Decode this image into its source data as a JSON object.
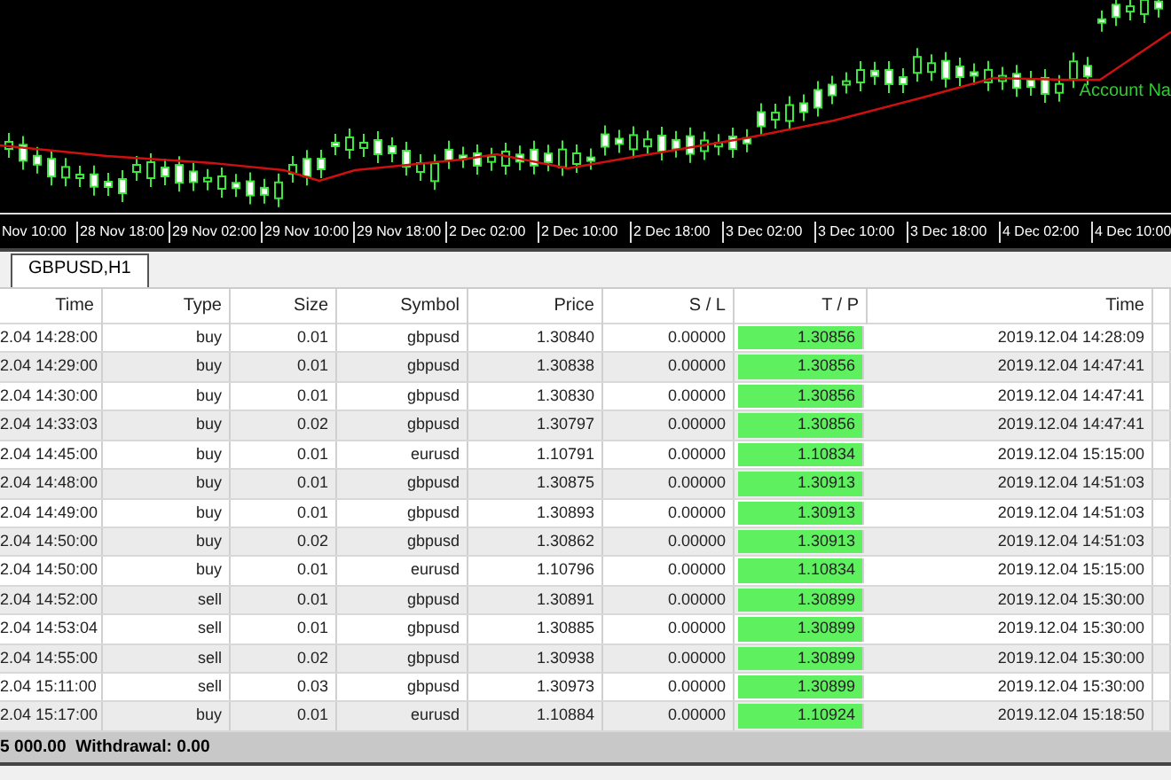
{
  "chart": {
    "account_label": "Account Na",
    "time_axis": [
      "Nov 10:00",
      "28 Nov 18:00",
      "29 Nov 02:00",
      "29 Nov 10:00",
      "29 Nov 18:00",
      "2 Dec 02:00",
      "2 Dec 10:00",
      "2 Dec 18:00",
      "3 Dec 02:00",
      "3 Dec 10:00",
      "3 Dec 18:00",
      "4 Dec 02:00",
      "4 Dec 10:00"
    ]
  },
  "chart_tabs": [
    {
      "label": "GBPUSD,H1",
      "selected": true
    }
  ],
  "table": {
    "columns": [
      "Time",
      "Type",
      "Size",
      "Symbol",
      "Price",
      "S / L",
      "T / P",
      "Time"
    ],
    "rows": [
      {
        "cells": [
          "2.04 14:28:00",
          "buy",
          "0.01",
          "gbpusd",
          "1.30840",
          "0.00000",
          "1.30856",
          "2019.12.04 14:28:09"
        ],
        "tp_hit": true
      },
      {
        "cells": [
          "2.04 14:29:00",
          "buy",
          "0.01",
          "gbpusd",
          "1.30838",
          "0.00000",
          "1.30856",
          "2019.12.04 14:47:41"
        ],
        "tp_hit": true
      },
      {
        "cells": [
          "2.04 14:30:00",
          "buy",
          "0.01",
          "gbpusd",
          "1.30830",
          "0.00000",
          "1.30856",
          "2019.12.04 14:47:41"
        ],
        "tp_hit": true
      },
      {
        "cells": [
          "2.04 14:33:03",
          "buy",
          "0.02",
          "gbpusd",
          "1.30797",
          "0.00000",
          "1.30856",
          "2019.12.04 14:47:41"
        ],
        "tp_hit": true
      },
      {
        "cells": [
          "2.04 14:45:00",
          "buy",
          "0.01",
          "eurusd",
          "1.10791",
          "0.00000",
          "1.10834",
          "2019.12.04 15:15:00"
        ],
        "tp_hit": true
      },
      {
        "cells": [
          "2.04 14:48:00",
          "buy",
          "0.01",
          "gbpusd",
          "1.30875",
          "0.00000",
          "1.30913",
          "2019.12.04 14:51:03"
        ],
        "tp_hit": true
      },
      {
        "cells": [
          "2.04 14:49:00",
          "buy",
          "0.01",
          "gbpusd",
          "1.30893",
          "0.00000",
          "1.30913",
          "2019.12.04 14:51:03"
        ],
        "tp_hit": true
      },
      {
        "cells": [
          "2.04 14:50:00",
          "buy",
          "0.02",
          "gbpusd",
          "1.30862",
          "0.00000",
          "1.30913",
          "2019.12.04 14:51:03"
        ],
        "tp_hit": true
      },
      {
        "cells": [
          "2.04 14:50:00",
          "buy",
          "0.01",
          "eurusd",
          "1.10796",
          "0.00000",
          "1.10834",
          "2019.12.04 15:15:00"
        ],
        "tp_hit": true
      },
      {
        "cells": [
          "2.04 14:52:00",
          "sell",
          "0.01",
          "gbpusd",
          "1.30891",
          "0.00000",
          "1.30899",
          "2019.12.04 15:30:00"
        ],
        "tp_hit": true
      },
      {
        "cells": [
          "2.04 14:53:04",
          "sell",
          "0.01",
          "gbpusd",
          "1.30885",
          "0.00000",
          "1.30899",
          "2019.12.04 15:30:00"
        ],
        "tp_hit": true
      },
      {
        "cells": [
          "2.04 14:55:00",
          "sell",
          "0.02",
          "gbpusd",
          "1.30938",
          "0.00000",
          "1.30899",
          "2019.12.04 15:30:00"
        ],
        "tp_hit": true
      },
      {
        "cells": [
          "2.04 15:11:00",
          "sell",
          "0.03",
          "gbpusd",
          "1.30973",
          "0.00000",
          "1.30899",
          "2019.12.04 15:30:00"
        ],
        "tp_hit": true
      },
      {
        "cells": [
          "2.04 15:17:00",
          "buy",
          "0.01",
          "eurusd",
          "1.10884",
          "0.00000",
          "1.10924",
          "2019.12.04 15:18:50"
        ],
        "tp_hit": true
      }
    ],
    "summary": "5 000.00  Withdrawal: 0.00"
  }
}
